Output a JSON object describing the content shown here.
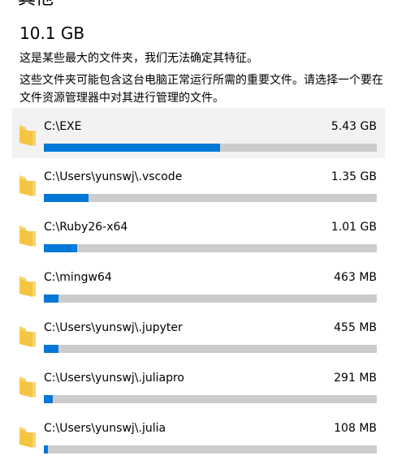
{
  "page": {
    "heading": "其他",
    "total_size": "10.1 GB",
    "description_1": "这是某些最大的文件夹，我们无法确定其特征。",
    "description_2": "这些文件夹可能包含这台电脑正常运行所需的重要文件。请选择一个要在文件资源管理器中对其进行管理的文件。"
  },
  "folders": [
    {
      "path": "C:\\EXE",
      "size": "5.43 GB",
      "usage_fraction": 0.53,
      "selected": true
    },
    {
      "path": "C:\\Users\\yunswj\\.vscode",
      "size": "1.35 GB",
      "usage_fraction": 0.133,
      "selected": false
    },
    {
      "path": "C:\\Ruby26-x64",
      "size": "1.01 GB",
      "usage_fraction": 0.1,
      "selected": false
    },
    {
      "path": "C:\\mingw64",
      "size": "463 MB",
      "usage_fraction": 0.045,
      "selected": false
    },
    {
      "path": "C:\\Users\\yunswj\\.jupyter",
      "size": "455 MB",
      "usage_fraction": 0.044,
      "selected": false
    },
    {
      "path": "C:\\Users\\yunswj\\.juliapro",
      "size": "291 MB",
      "usage_fraction": 0.028,
      "selected": false
    },
    {
      "path": "C:\\Users\\yunswj\\.julia",
      "size": "108 MB",
      "usage_fraction": 0.011,
      "selected": false
    }
  ],
  "colors": {
    "usage_fill": "#0078d7",
    "usage_track": "#cccccc",
    "folder_icon": "#f5c542",
    "selected_row": "#f2f2f2"
  },
  "icons": {
    "folder": "folder-icon"
  }
}
